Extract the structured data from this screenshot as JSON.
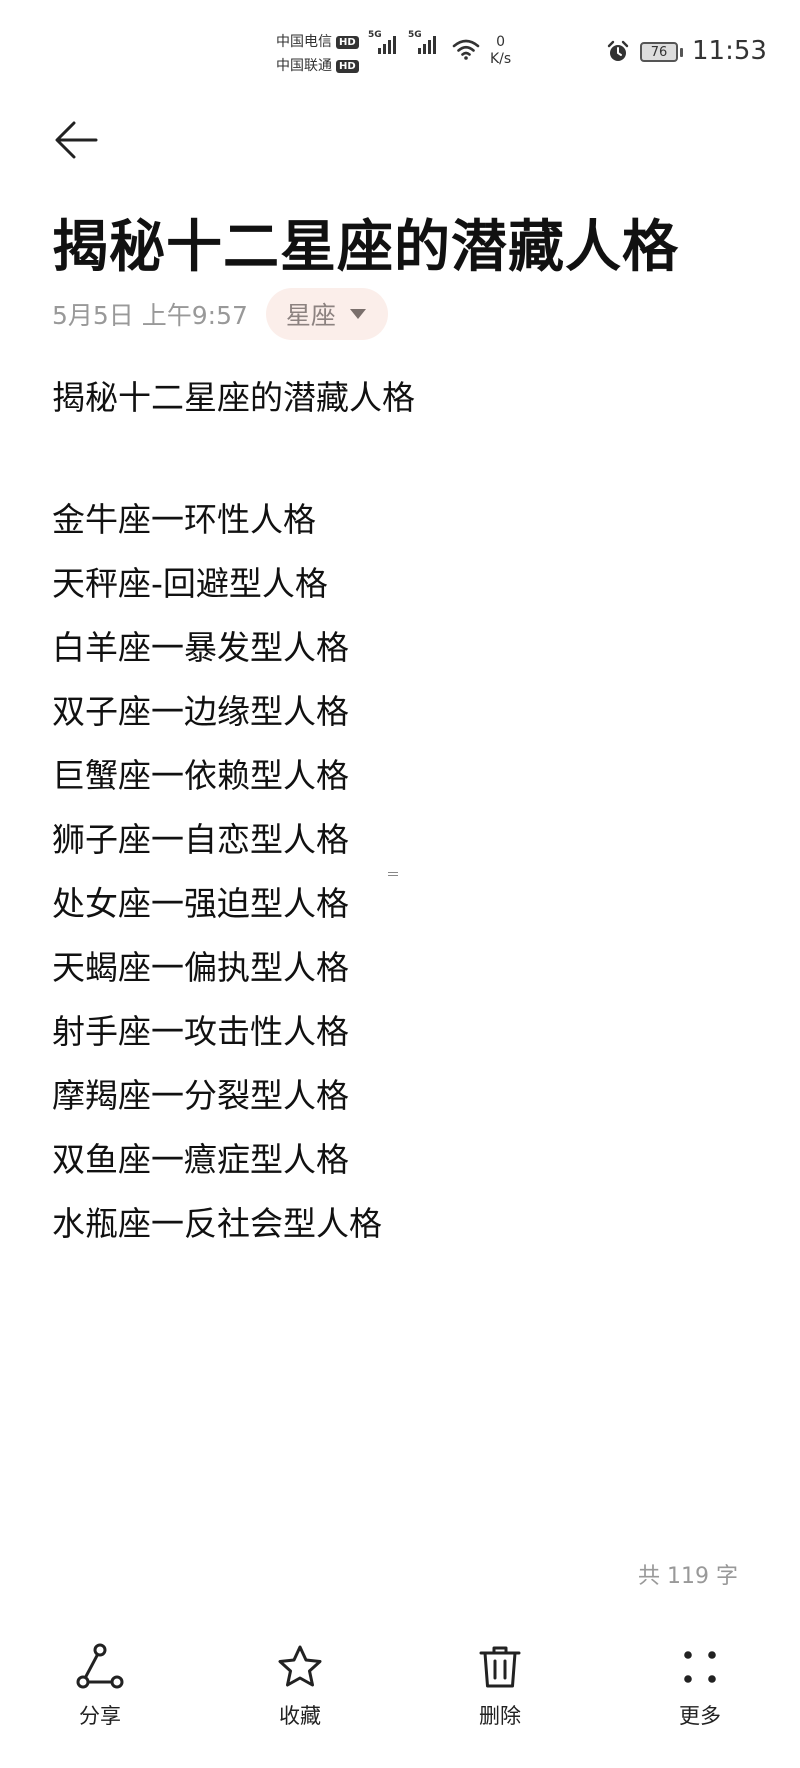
{
  "status_bar": {
    "carrier_1": "中国电信",
    "carrier_2": "中国联通",
    "hd_label": "HD",
    "network_tag": "5G",
    "net_speed_value": "0",
    "net_speed_unit": "K/s",
    "battery": "76",
    "time": "11:53"
  },
  "note": {
    "title": "揭秘十二星座的潜藏人格",
    "date": "5月5日 上午9:57",
    "category": "星座",
    "lines": [
      "揭秘十二星座的潜藏人格",
      "金牛座一环性人格",
      "天秤座-回避型人格",
      "白羊座一暴发型人格",
      "双子座一边缘型人格",
      "巨蟹座一依赖型人格",
      "狮子座一自恋型人格",
      "处女座一强迫型人格",
      "天蝎座一偏执型人格",
      "射手座一攻击性人格",
      "摩羯座一分裂型人格",
      "双鱼座一癔症型人格",
      "水瓶座一反社会型人格"
    ],
    "word_count": "共 119 字"
  },
  "toolbar": {
    "share": "分享",
    "favorite": "收藏",
    "delete": "删除",
    "more": "更多"
  }
}
